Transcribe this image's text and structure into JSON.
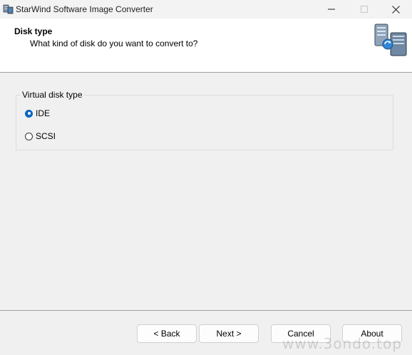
{
  "window": {
    "title": "StarWind Software Image Converter"
  },
  "header": {
    "title": "Disk type",
    "subtitle": "What kind of disk do you want to convert to?"
  },
  "disk_type_group": {
    "label": "Virtual disk type",
    "options": [
      {
        "label": "IDE",
        "selected": true
      },
      {
        "label": "SCSI",
        "selected": false
      }
    ]
  },
  "buttons": {
    "back": "< Back",
    "next": "Next >",
    "cancel": "Cancel",
    "about": "About"
  },
  "watermark": "www.3ondo.top",
  "colors": {
    "accent": "#0067c0",
    "header_bg": "#ffffff",
    "window_bg": "#f0f0f0"
  },
  "icons": {
    "app": "server-disk-icon",
    "header": "server-convert-icon",
    "minimize": "minimize-icon",
    "maximize": "maximize-icon",
    "close": "close-icon"
  }
}
